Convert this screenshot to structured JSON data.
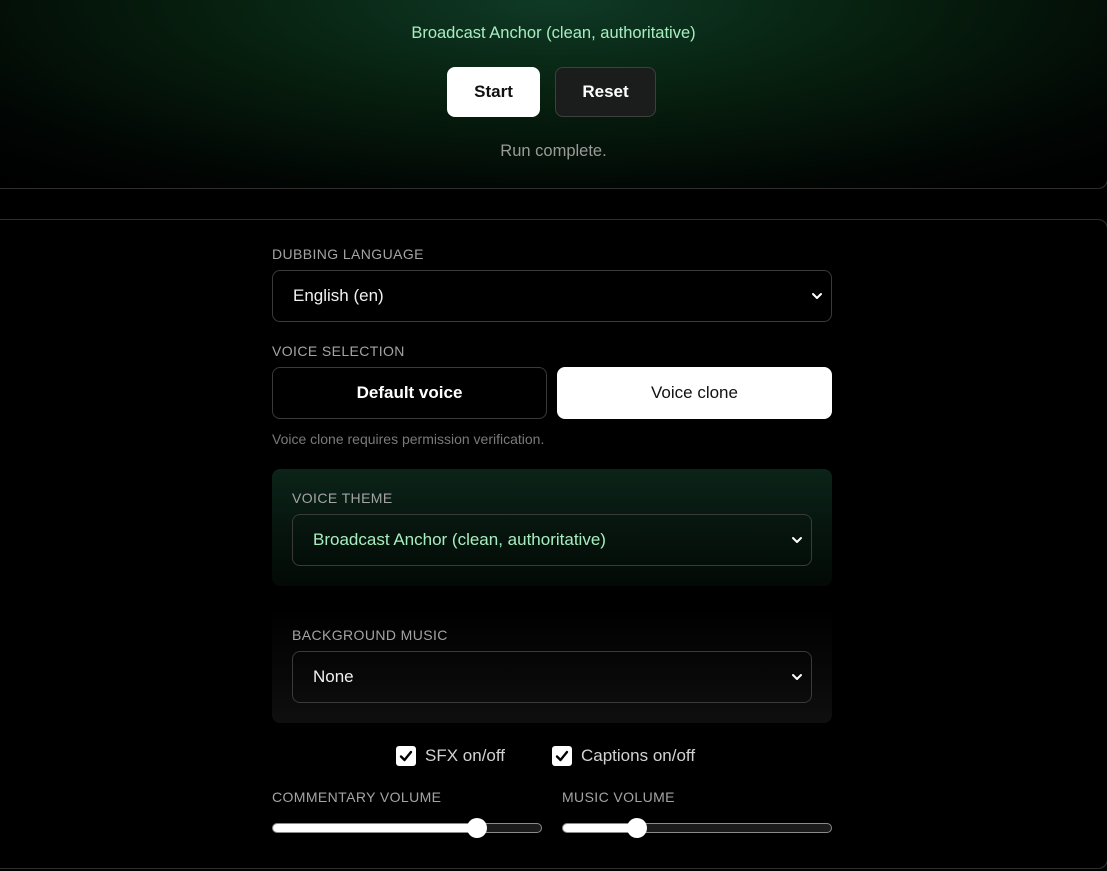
{
  "header": {
    "current_theme": "Broadcast Anchor (clean, authoritative)",
    "start_label": "Start",
    "reset_label": "Reset",
    "status": "Run complete."
  },
  "dubbing": {
    "label": "DUBBING LANGUAGE",
    "value": "English (en)"
  },
  "voice_selection": {
    "label": "VOICE SELECTION",
    "default_label": "Default voice",
    "clone_label": "Voice clone",
    "selected": "Voice clone",
    "hint": "Voice clone requires permission verification."
  },
  "voice_theme": {
    "label": "VOICE THEME",
    "value": "Broadcast Anchor (clean, authoritative)"
  },
  "background_music": {
    "label": "BACKGROUND MUSIC",
    "value": "None"
  },
  "toggles": {
    "sfx_label": "SFX on/off",
    "sfx_checked": true,
    "captions_label": "Captions on/off",
    "captions_checked": true
  },
  "volumes": {
    "commentary_label": "COMMENTARY VOLUME",
    "commentary_level": 0.78,
    "music_label": "MUSIC VOLUME",
    "music_level": 0.26
  },
  "colors": {
    "accent_text": "#a6eec0",
    "panel_border": "#2e2e2e",
    "muted_text": "#9a9a9a"
  }
}
